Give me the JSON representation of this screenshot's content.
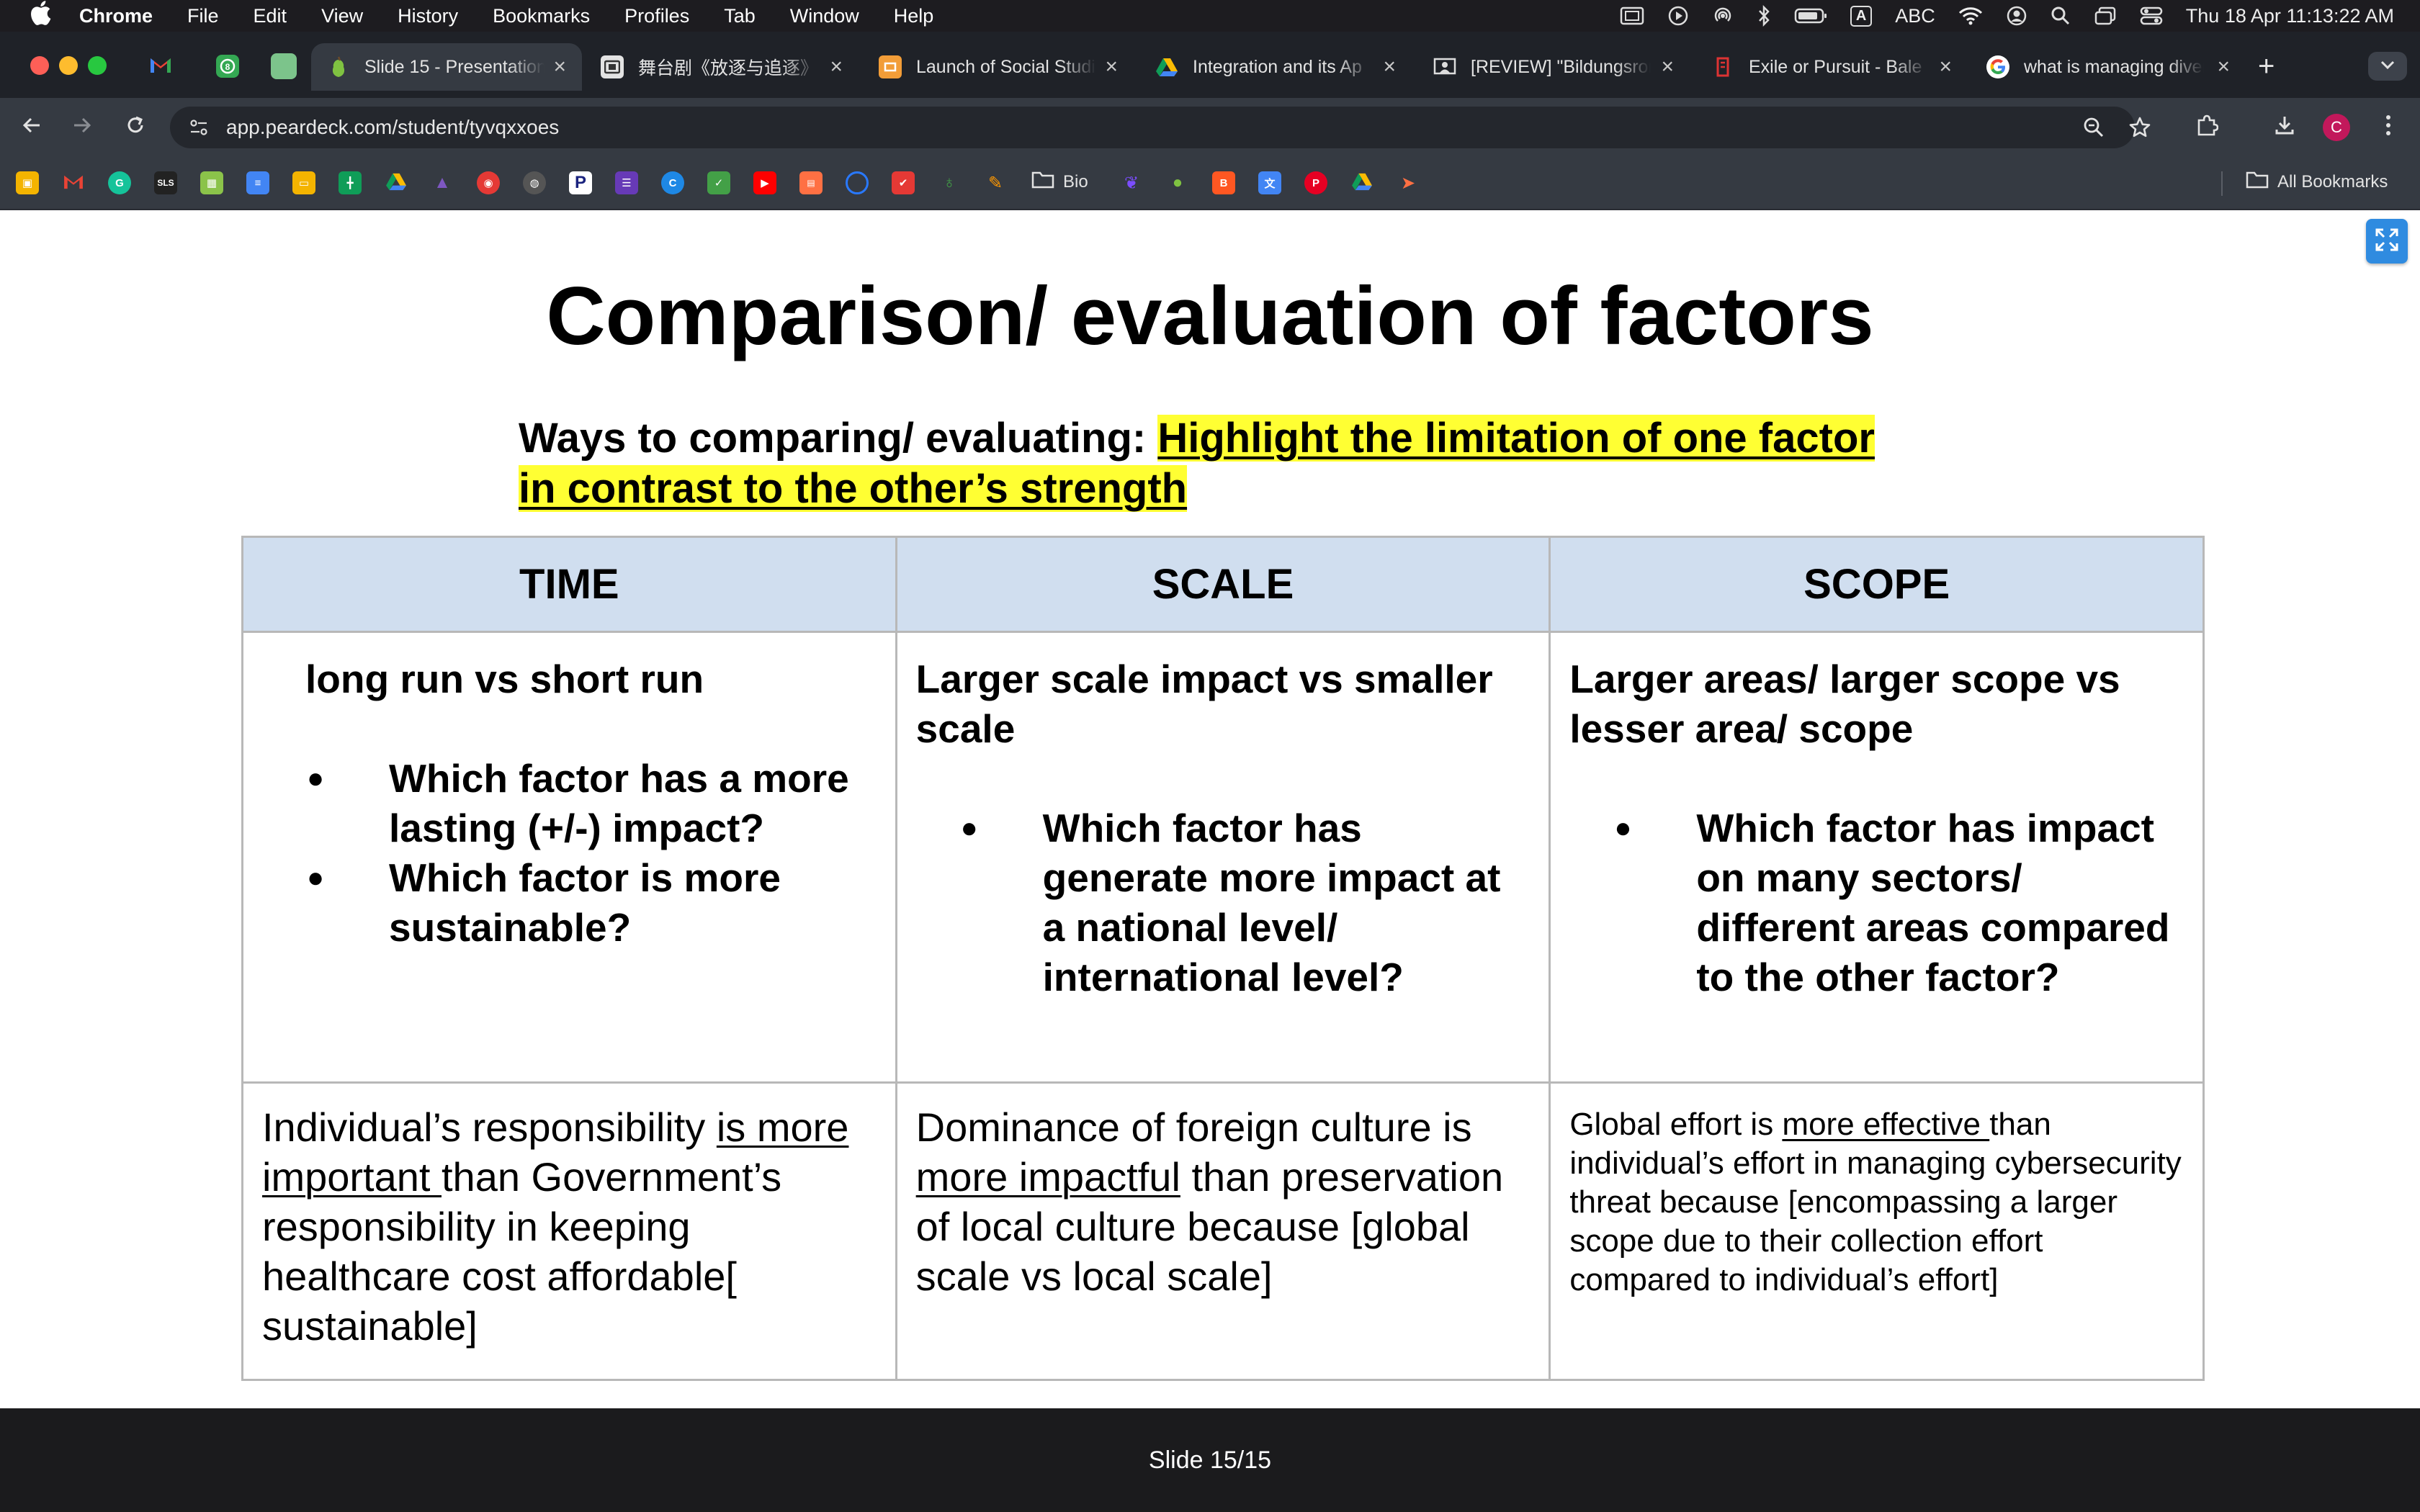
{
  "menubar": {
    "app_name": "Chrome",
    "items": [
      "File",
      "Edit",
      "View",
      "History",
      "Bookmarks",
      "Profiles",
      "Tab",
      "Window",
      "Help"
    ],
    "input_source": "ABC",
    "clock": "Thu 18 Apr  11:13:22 AM"
  },
  "tabs": [
    {
      "title": "Slide 15 - Presentation",
      "favicon": "peardeck-icon",
      "active": true
    },
    {
      "title": "舞台剧《放逐与追逐》",
      "favicon": "slides-icon",
      "active": false
    },
    {
      "title": "Launch of Social Studies",
      "favicon": "slides-icon",
      "active": false
    },
    {
      "title": "Integration and its Ap",
      "favicon": "drive-icon",
      "active": false
    },
    {
      "title": "[REVIEW] \"Bildungsroman",
      "favicon": "classroom-icon",
      "active": false
    },
    {
      "title": "Exile or Pursuit - Bale",
      "favicon": "page-icon",
      "active": false
    },
    {
      "title": "what is managing diversity",
      "favicon": "google-icon",
      "active": false
    }
  ],
  "pinned_tabs": [
    "gmail-icon",
    "messages-icon",
    "sheets-icon"
  ],
  "address_bar": {
    "url": "app.peardeck.com/student/tyvqxxoes"
  },
  "avatar_letter": "C",
  "bookmarks": {
    "icons": [
      "slides-icon",
      "gmail-icon",
      "grammarly-icon",
      "sls-icon",
      "timetable-icon",
      "docs-icon",
      "slides-icon",
      "sheets-icon",
      "drive-icon",
      "app-icon",
      "app-icon",
      "globe-icon",
      "p-icon",
      "forms-icon",
      "c-icon",
      "app-icon",
      "youtube-icon",
      "slides-icon",
      "app-icon",
      "pocket-icon",
      "app-icon",
      "app-icon"
    ],
    "icon_labels": {
      "sls": "SLS"
    },
    "folder_label": "Bio",
    "all_bookmarks_label": "All Bookmarks"
  },
  "slide": {
    "title": "Comparison/ evaluation of factors",
    "subtitle_prefix": "Ways to comparing/ evaluating: ",
    "subtitle_highlight": "Highlight the limitation of one factor in contrast to the other’s strength",
    "columns": [
      {
        "header": "TIME",
        "lead": "long run vs short run",
        "questions": [
          "Which factor has a more lasting (+/-) impact?",
          "Which factor is more sustainable?"
        ],
        "example_before": "Individual’s responsibility ",
        "example_underline": "is more important ",
        "example_after": "than Government’s responsibility in keeping healthcare cost affordable[ sustainable]"
      },
      {
        "header": "SCALE",
        "lead": "Larger scale impact vs smaller scale",
        "questions": [
          "Which factor has generate more impact at a national level/ international level?"
        ],
        "example_before": "Dominance of foreign culture is ",
        "example_underline": "more impactful",
        "example_after": " than preservation of local culture because [global scale vs local scale]"
      },
      {
        "header": "SCOPE",
        "lead": "Larger areas/ larger scope vs lesser area/ scope",
        "questions": [
          "Which factor has impact on many sectors/ different areas compared to the other factor?"
        ],
        "example_before": "Global effort is ",
        "example_underline": "more effective ",
        "example_after": "than individual’s effort in managing cybersecurity threat because [encompassing a larger scope due to their collection effort compared to individual’s effort]"
      }
    ]
  },
  "footer": {
    "slide_counter": "Slide 15/15"
  },
  "colors": {
    "header_bg": "#d0deef",
    "highlight": "#ffff33",
    "footer_bg": "#1b1b1d",
    "accent": "#2f8be0"
  }
}
